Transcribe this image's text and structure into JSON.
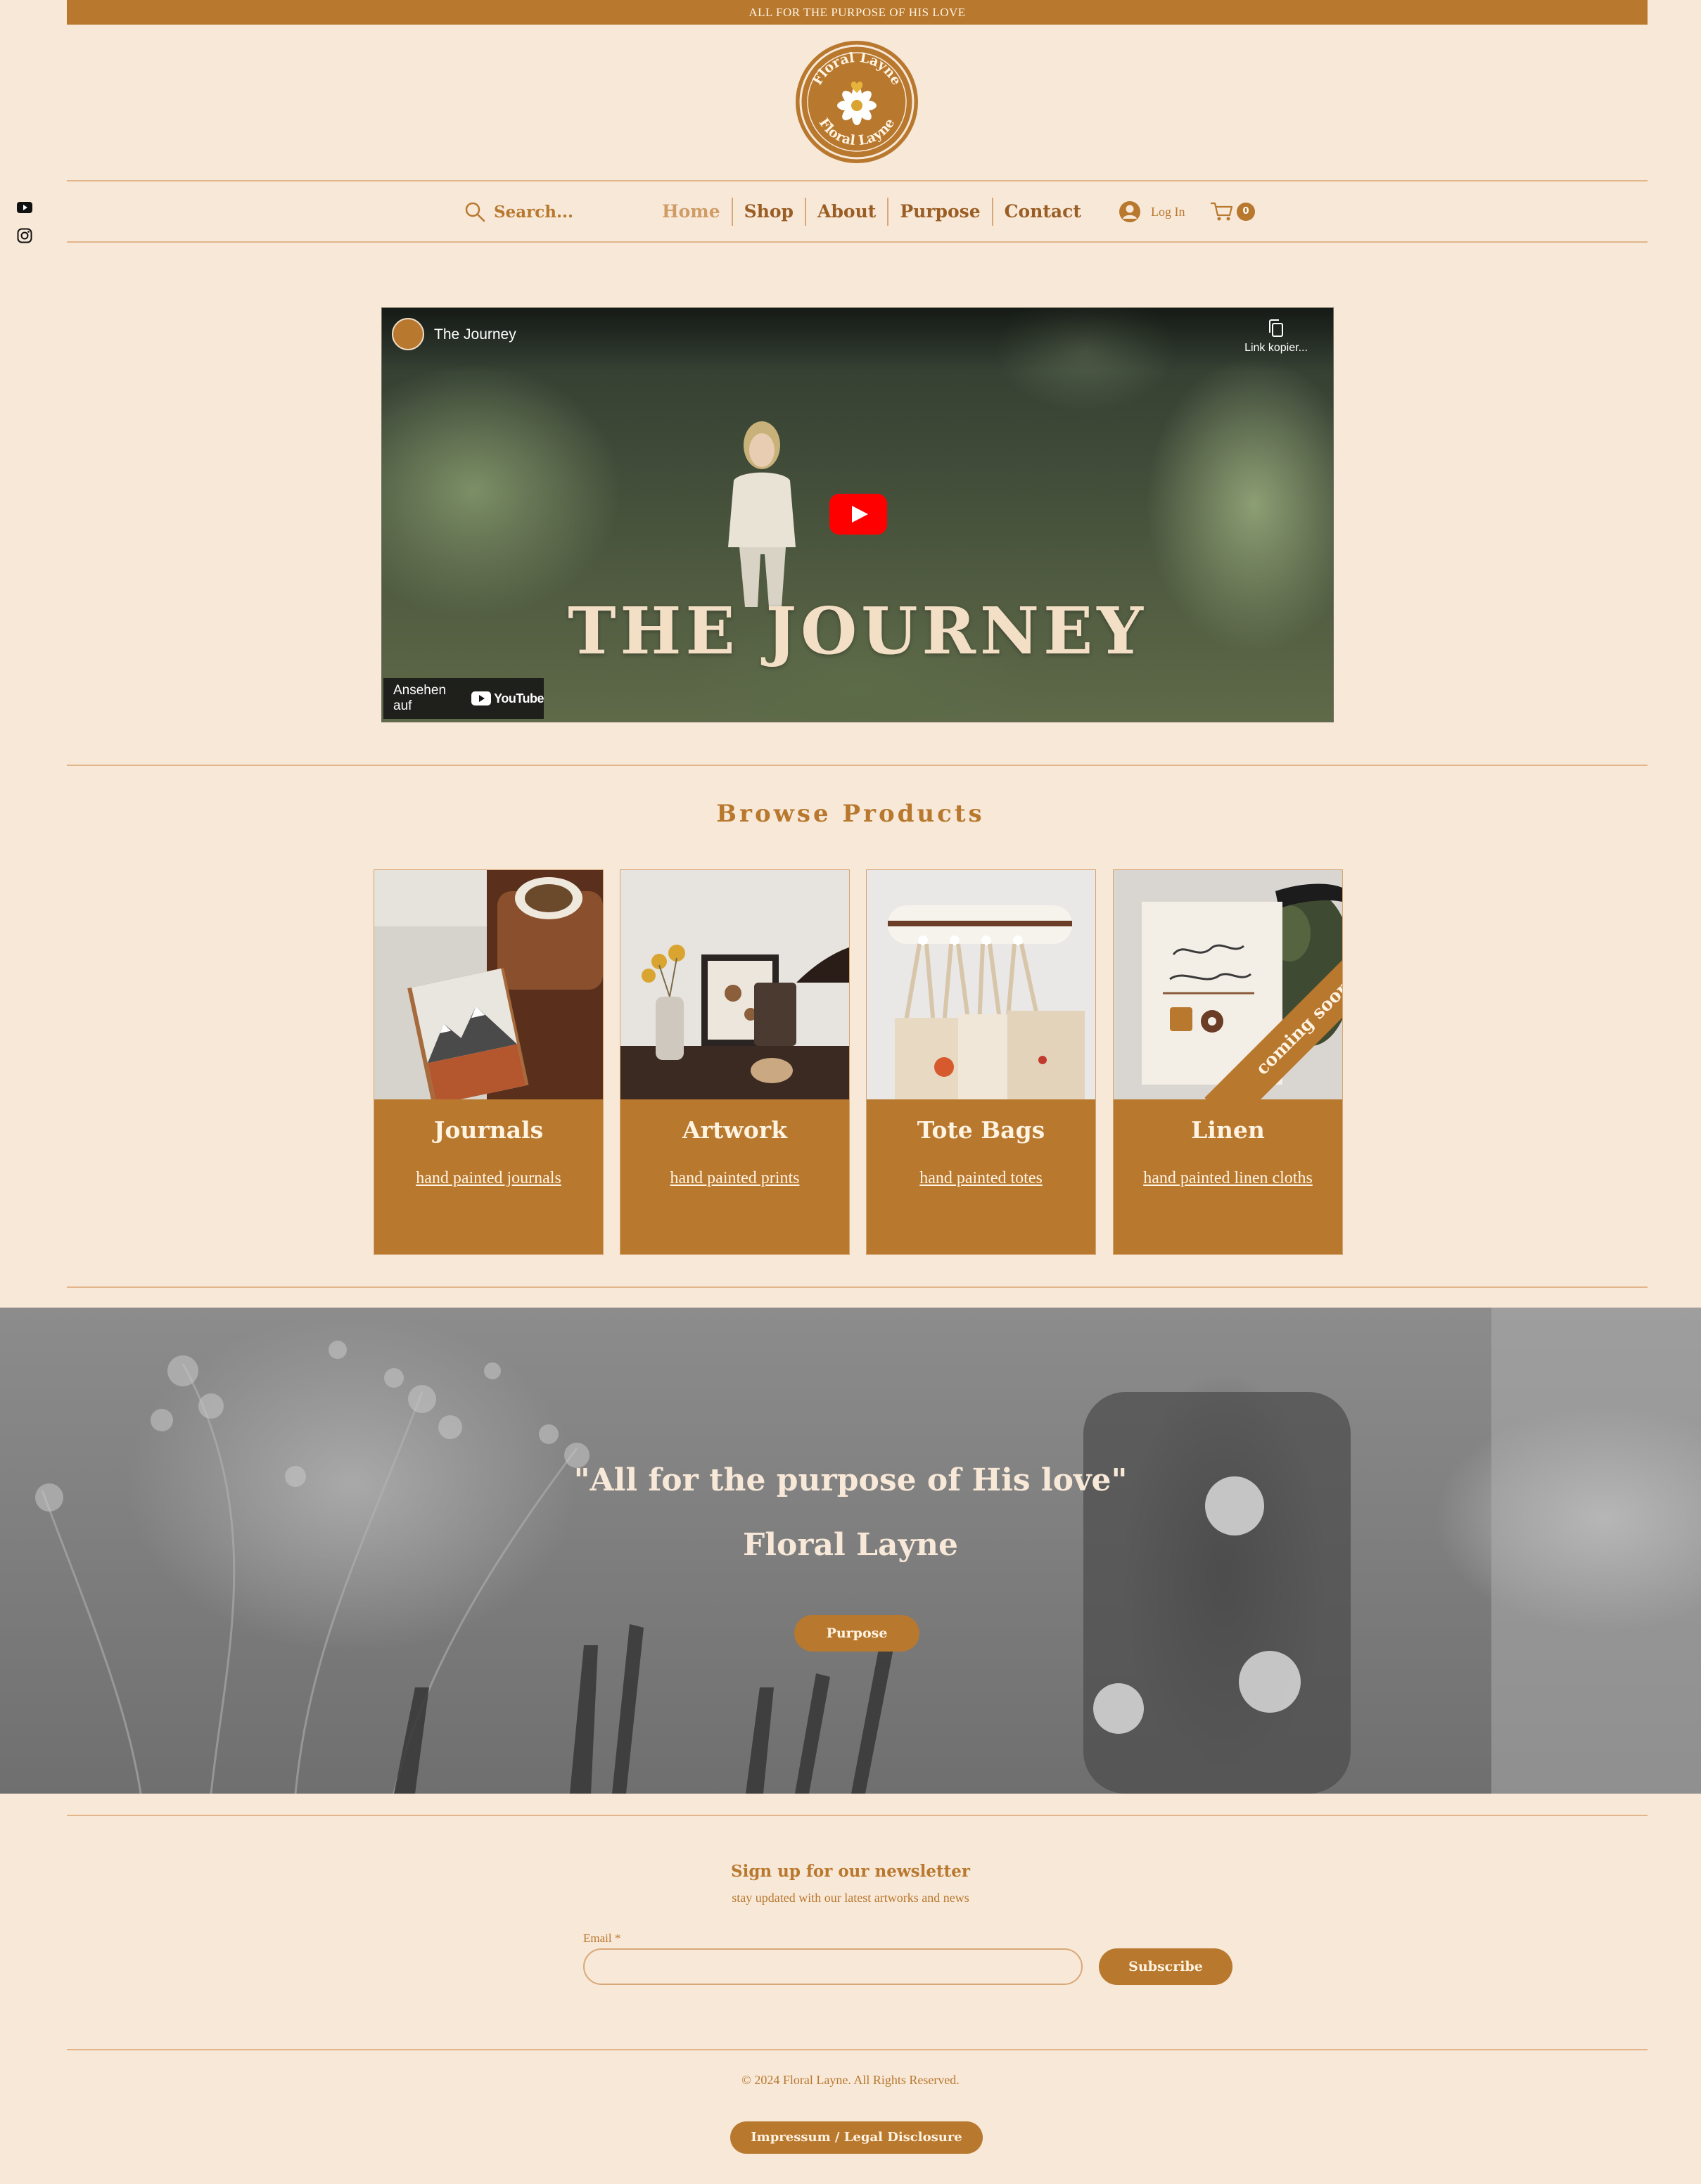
{
  "announcement": "ALL FOR THE PURPOSE OF HIS LOVE",
  "logo": {
    "text": "Floral Layne"
  },
  "social": {
    "youtube": "youtube-icon",
    "instagram": "instagram-icon"
  },
  "header": {
    "search_placeholder": "Search...",
    "menu": [
      "Home",
      "Shop",
      "About",
      "Purpose",
      "Contact"
    ],
    "login_label": "Log In",
    "cart_count": "0"
  },
  "video": {
    "title": "The Journey",
    "copy_label": "Link kopier...",
    "headline": "THE JOURNEY",
    "watch_on": "Ansehen auf",
    "youtube_label": "YouTube"
  },
  "browse": {
    "title": "Browse Products",
    "products": [
      {
        "name": "Journals",
        "subtitle": "hand painted journals"
      },
      {
        "name": "Artwork",
        "subtitle": "hand painted prints"
      },
      {
        "name": "Tote Bags",
        "subtitle": "hand painted totes"
      },
      {
        "name": "Linen",
        "subtitle": "hand painted linen cloths",
        "ribbon": "coming soon"
      }
    ]
  },
  "banner": {
    "quote": "\"All for the purpose of His love\"",
    "author": "Floral Layne",
    "button": "Purpose"
  },
  "newsletter": {
    "title": "Sign up for our newsletter",
    "subtitle": "stay updated with our latest artworks and news",
    "email_label": "Email *",
    "email_value": "",
    "subscribe": "Subscribe"
  },
  "footer": {
    "copyright": "© 2024 Floral Layne. All Rights Reserved.",
    "impressum": "Impressum / Legal Disclosure"
  },
  "colors": {
    "brand": "#b8782e",
    "background": "#f8e8d8",
    "youtube_red": "#ff0000"
  }
}
